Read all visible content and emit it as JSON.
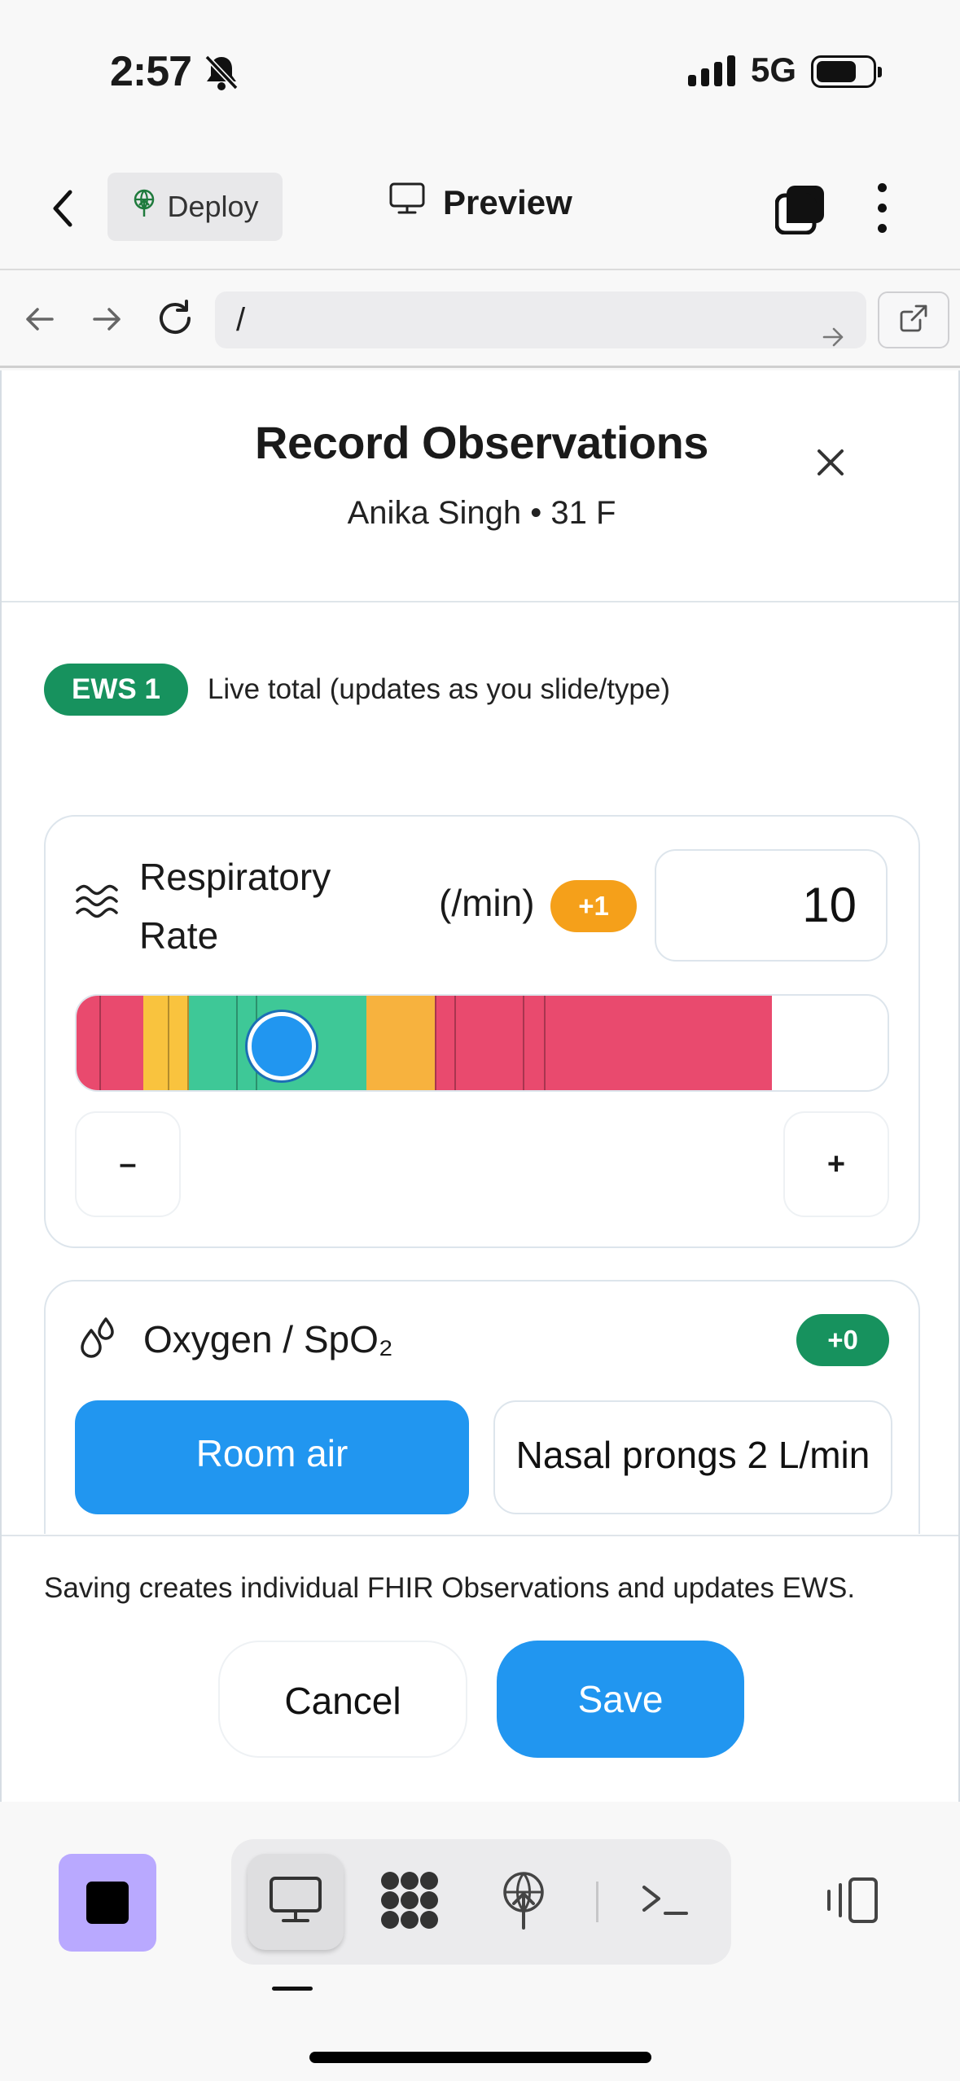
{
  "status_bar": {
    "time": "2:57",
    "network": "5G"
  },
  "toolbar": {
    "deploy_label": "Deploy",
    "preview_label": "Preview"
  },
  "url_bar": {
    "url": "/"
  },
  "modal": {
    "title": "Record Observations",
    "subtitle": "Anika Singh • 31 F",
    "ews": {
      "badge": "EWS 1",
      "caption": "Live total (updates as you slide/type)"
    },
    "respiratory": {
      "label": "Respiratory Rate",
      "unit": "(/min)",
      "points_badge": "+1",
      "value": "10",
      "slider_value": 10,
      "minus_label": "–",
      "plus_label": "+",
      "band_colors": {
        "red": "#e94a6e",
        "amber": "#f7b23e",
        "yellow": "#f9c33e",
        "green": "#3ec897"
      }
    },
    "oxygen": {
      "label": "Oxygen / SpO₂",
      "points_badge": "+0",
      "options": [
        "Room air",
        "Nasal prongs 2 L/min"
      ],
      "selected": "Room air"
    },
    "footer_note": "Saving creates individual FHIR Observations and updates EWS.",
    "cancel_label": "Cancel",
    "save_label": "Save"
  },
  "colors": {
    "accent": "#2196f0",
    "ews_green": "#17925e",
    "warn_orange": "#f5a01a",
    "stop_purple": "#b9a9ff"
  }
}
